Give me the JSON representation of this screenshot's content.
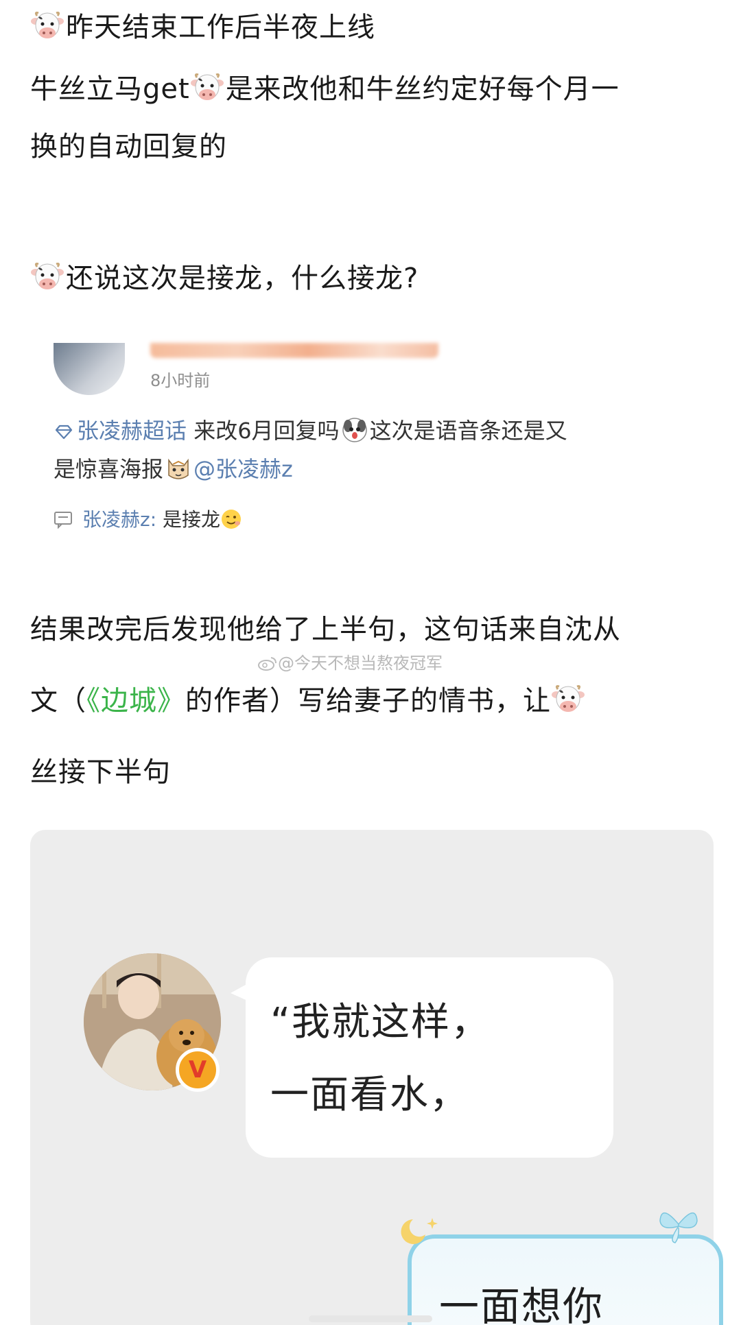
{
  "paragraphs": {
    "p1_line1": "昨天结束工作后半夜上线",
    "p1_line2_a": "牛丝立马get",
    "p1_line2_b": "是来改他和牛丝约定好每个月一",
    "p1_line3": "换的自动回复的",
    "p2": "还说这次是接龙，什么接龙?",
    "p3_line1": "结果改完后发现他给了上半句，这句话来自沈从",
    "p3_line2_a": "文（",
    "p3_line2_book": "《边城》",
    "p3_line2_b": "的作者）写给妻子的情书，让",
    "p3_line3": "丝接下半句"
  },
  "post": {
    "time": "8小时前",
    "topic": "张凌赫超话",
    "body_a": "来改6月回复吗",
    "body_b": "这次是语音条还是又",
    "body_c": "是惊喜海报",
    "mention": "@张凌赫z",
    "reply_name": "张凌赫z:",
    "reply_text": "是接龙"
  },
  "watermark": "@今天不想当熬夜冠军",
  "panel": {
    "bubble_line1": "“我就这样，",
    "bubble_line2": "一面看水，",
    "reply_line": "一面想你"
  },
  "icons": {
    "cow": "cow-face-emoji",
    "topic": "diamond-icon",
    "reply": "comment-icon",
    "weibo": "weibo-logo-icon",
    "verified": "verified-v-badge"
  },
  "colors": {
    "link_blue": "#5b7fb0",
    "book_green": "#3bb44a",
    "panel_grey": "#ededed"
  }
}
